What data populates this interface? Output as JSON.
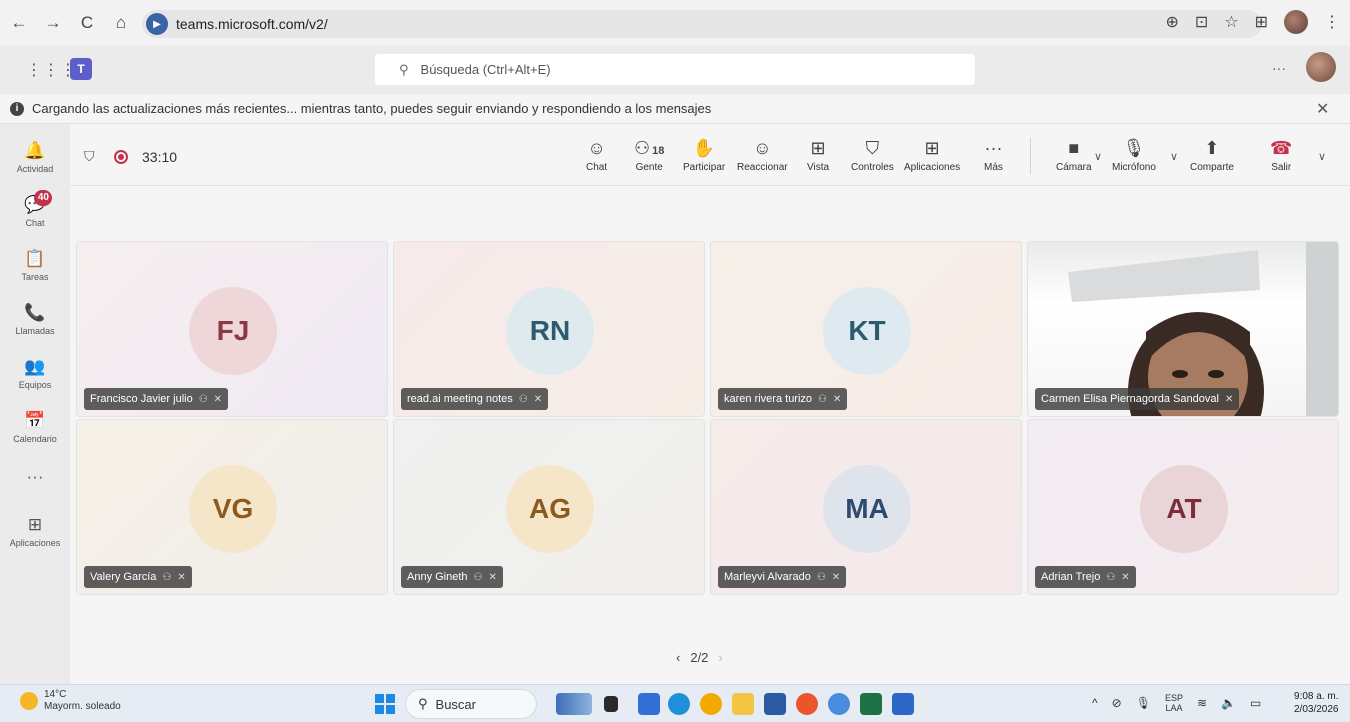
{
  "browser": {
    "url": "teams.microsoft.com/v2/",
    "nav": {
      "back": "←",
      "forward": "→",
      "reload": "C",
      "home": "⌂"
    },
    "actions": {
      "zoom": "⊕",
      "cast": "⊡",
      "star": "☆",
      "extensions": "⊞",
      "menu": "⋮"
    }
  },
  "teams_header": {
    "search_placeholder": "Búsqueda (Ctrl+Alt+E)",
    "more": "···"
  },
  "notice": {
    "text": "Cargando las actualizaciones más recientes... mientras tanto, puedes seguir enviando y respondiendo a los mensajes",
    "close": "✕"
  },
  "rail": {
    "items": [
      {
        "label": "Actividad",
        "icon": "bell-icon",
        "glyph": "🔔"
      },
      {
        "label": "Chat",
        "icon": "chat-icon",
        "glyph": "💬",
        "badge": "40"
      },
      {
        "label": "Tareas",
        "icon": "tasks-icon",
        "glyph": "📋"
      },
      {
        "label": "Llamadas",
        "icon": "phone-icon",
        "glyph": "📞"
      },
      {
        "label": "Equipos",
        "icon": "teams-icon",
        "glyph": "👥"
      },
      {
        "label": "Calendario",
        "icon": "calendar-icon",
        "glyph": "📅"
      },
      {
        "label": "",
        "icon": "more-icon",
        "glyph": "···"
      },
      {
        "label": "Aplicaciones",
        "icon": "add-apps-icon",
        "glyph": "⊞"
      }
    ]
  },
  "meeting_toolbar": {
    "timer": "33:10",
    "people_count": "18",
    "buttons": [
      {
        "label": "Chat",
        "glyph": "☺"
      },
      {
        "label": "Gente",
        "glyph": "⚇"
      },
      {
        "label": "Participar",
        "glyph": "✋"
      },
      {
        "label": "Reaccionar",
        "glyph": "☺"
      },
      {
        "label": "Vista",
        "glyph": "⊞"
      },
      {
        "label": "Controles",
        "glyph": "⛉"
      },
      {
        "label": "Aplicaciones",
        "glyph": "⊞"
      },
      {
        "label": "Más",
        "glyph": "···"
      },
      {
        "label": "Cámara",
        "glyph": "■"
      },
      {
        "label": "Micrófono",
        "glyph": "🎙"
      },
      {
        "label": "Comparte",
        "glyph": "⬆"
      },
      {
        "label": "Salir",
        "glyph": "☎"
      }
    ]
  },
  "participants": [
    {
      "initials": "FJ",
      "name": "Francisco Javier julio"
    },
    {
      "initials": "RN",
      "name": "read.ai meeting notes"
    },
    {
      "initials": "KT",
      "name": "karen rivera turizo"
    },
    {
      "initials": "",
      "name": "Carmen Elisa Piernagorda Sandoval"
    },
    {
      "initials": "VG",
      "name": "Valery García"
    },
    {
      "initials": "AG",
      "name": "Anny Gineth"
    },
    {
      "initials": "MA",
      "name": "Marleyvi Alvarado"
    },
    {
      "initials": "AT",
      "name": "Adrian Trejo"
    }
  ],
  "pager": {
    "prev": "‹",
    "text": "2/2",
    "next": "›"
  },
  "taskbar": {
    "temperature": "14°C",
    "weather": "Mayorm. soleado",
    "search": "Buscar",
    "lang_top": "ESP",
    "lang_bottom": "LAA",
    "time": "9:08 a. m.",
    "date": "2/03/2026"
  }
}
